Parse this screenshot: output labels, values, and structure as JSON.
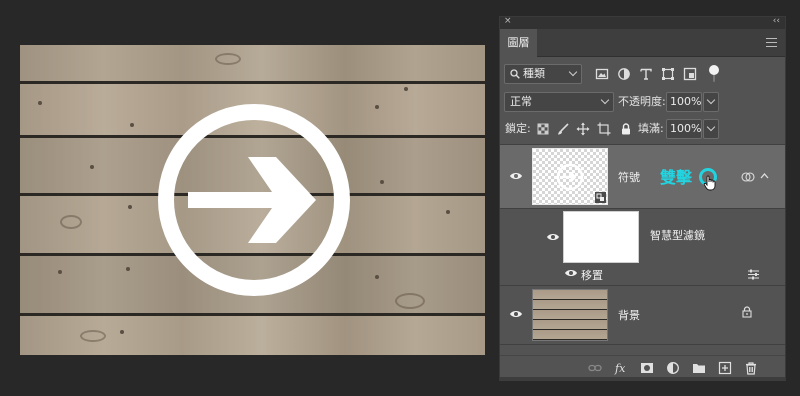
{
  "canvas": {
    "symbol": "right-arrow-in-circle"
  },
  "panel": {
    "tab_label": "圖層",
    "close_glyph": "×",
    "collapse_glyph": "‹‹",
    "filter": {
      "kind_label": "種類",
      "filter_icons": [
        "image-filter-icon",
        "adjustment-filter-icon",
        "type-filter-icon",
        "shape-filter-icon",
        "smart-object-filter-icon",
        "filter-toggle"
      ]
    },
    "blend": {
      "mode": "正常",
      "opacity_label": "不透明度:",
      "opacity_value": "100%"
    },
    "lock": {
      "label": "鎖定:",
      "fill_label": "填滿:",
      "fill_value": "100%",
      "lock_icons": [
        "lock-transparency-icon",
        "lock-paint-icon",
        "lock-position-icon",
        "lock-artboard-icon",
        "lock-all-icon"
      ]
    },
    "layers": [
      {
        "name": "符號",
        "annotation": "雙擊",
        "type": "smart-object",
        "selected": true,
        "visible": true
      },
      {
        "name": "智慧型濾鏡",
        "type": "smart-filter-mask",
        "visible": true
      },
      {
        "name": "移置",
        "type": "filter-effect",
        "visible": true
      },
      {
        "name": "背景",
        "type": "background",
        "locked": true,
        "visible": true
      }
    ],
    "bottom_icons": [
      "link-layers-icon",
      "fx-icon",
      "add-mask-icon",
      "adjustment-layer-icon",
      "new-group-icon",
      "new-layer-icon",
      "delete-layer-icon"
    ]
  },
  "colors": {
    "annotation_cyan": "#22d3e0",
    "panel_bg": "#535353",
    "selected_row": "#6a6a6a"
  }
}
